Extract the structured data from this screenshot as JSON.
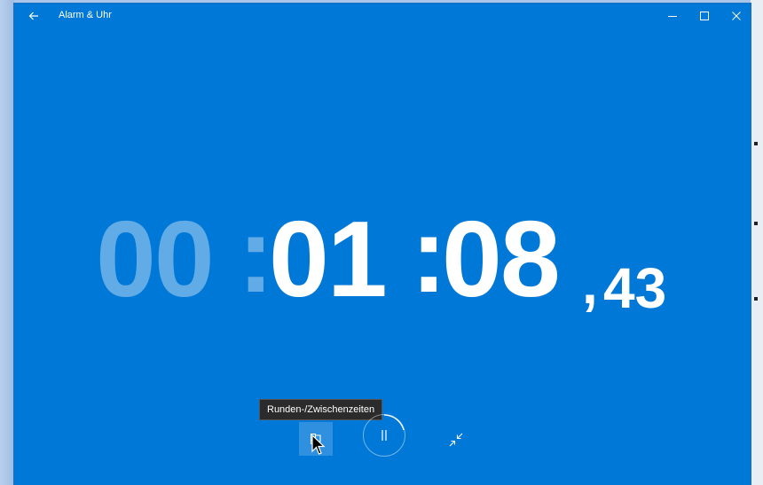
{
  "window": {
    "title": "Alarm & Uhr"
  },
  "titlebar": {
    "back_icon": "back-arrow-icon",
    "minimize_icon": "minimize-icon",
    "maximize_icon": "maximize-icon",
    "close_icon": "close-icon"
  },
  "stopwatch": {
    "hours": "00",
    "minutes": "01",
    "seconds": "08",
    "hundredths": "43",
    "separator": ":",
    "decimal_separator": ","
  },
  "controls": {
    "lap_tooltip": "Runden-/Zwischenzeiten",
    "lap_icon": "flag-icon",
    "pause_icon": "pause-icon",
    "compact_icon": "collapse-icon"
  },
  "colors": {
    "background": "#0078d7",
    "text": "#ffffff",
    "dimmed_text": "rgba(255,255,255,0.38)",
    "tooltip_bg": "#2b2b2b"
  }
}
